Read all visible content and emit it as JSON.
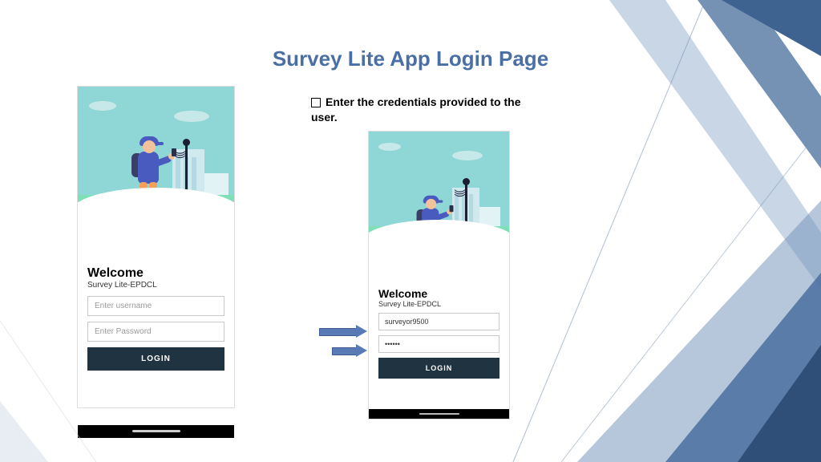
{
  "title": "Survey Lite App Login Page",
  "instruction": "Enter the credentials provided to the user.",
  "screens": {
    "empty": {
      "welcome": "Welcome",
      "subtitle": "Survey Lite-EPDCL",
      "username_placeholder": "Enter username",
      "password_placeholder": "Enter Password",
      "login_label": "LOGIN"
    },
    "filled": {
      "welcome": "Welcome",
      "subtitle": "Survey Lite-EPDCL",
      "username_value": "surveyor9500",
      "password_value": "••••••",
      "login_label": "LOGIN"
    }
  }
}
